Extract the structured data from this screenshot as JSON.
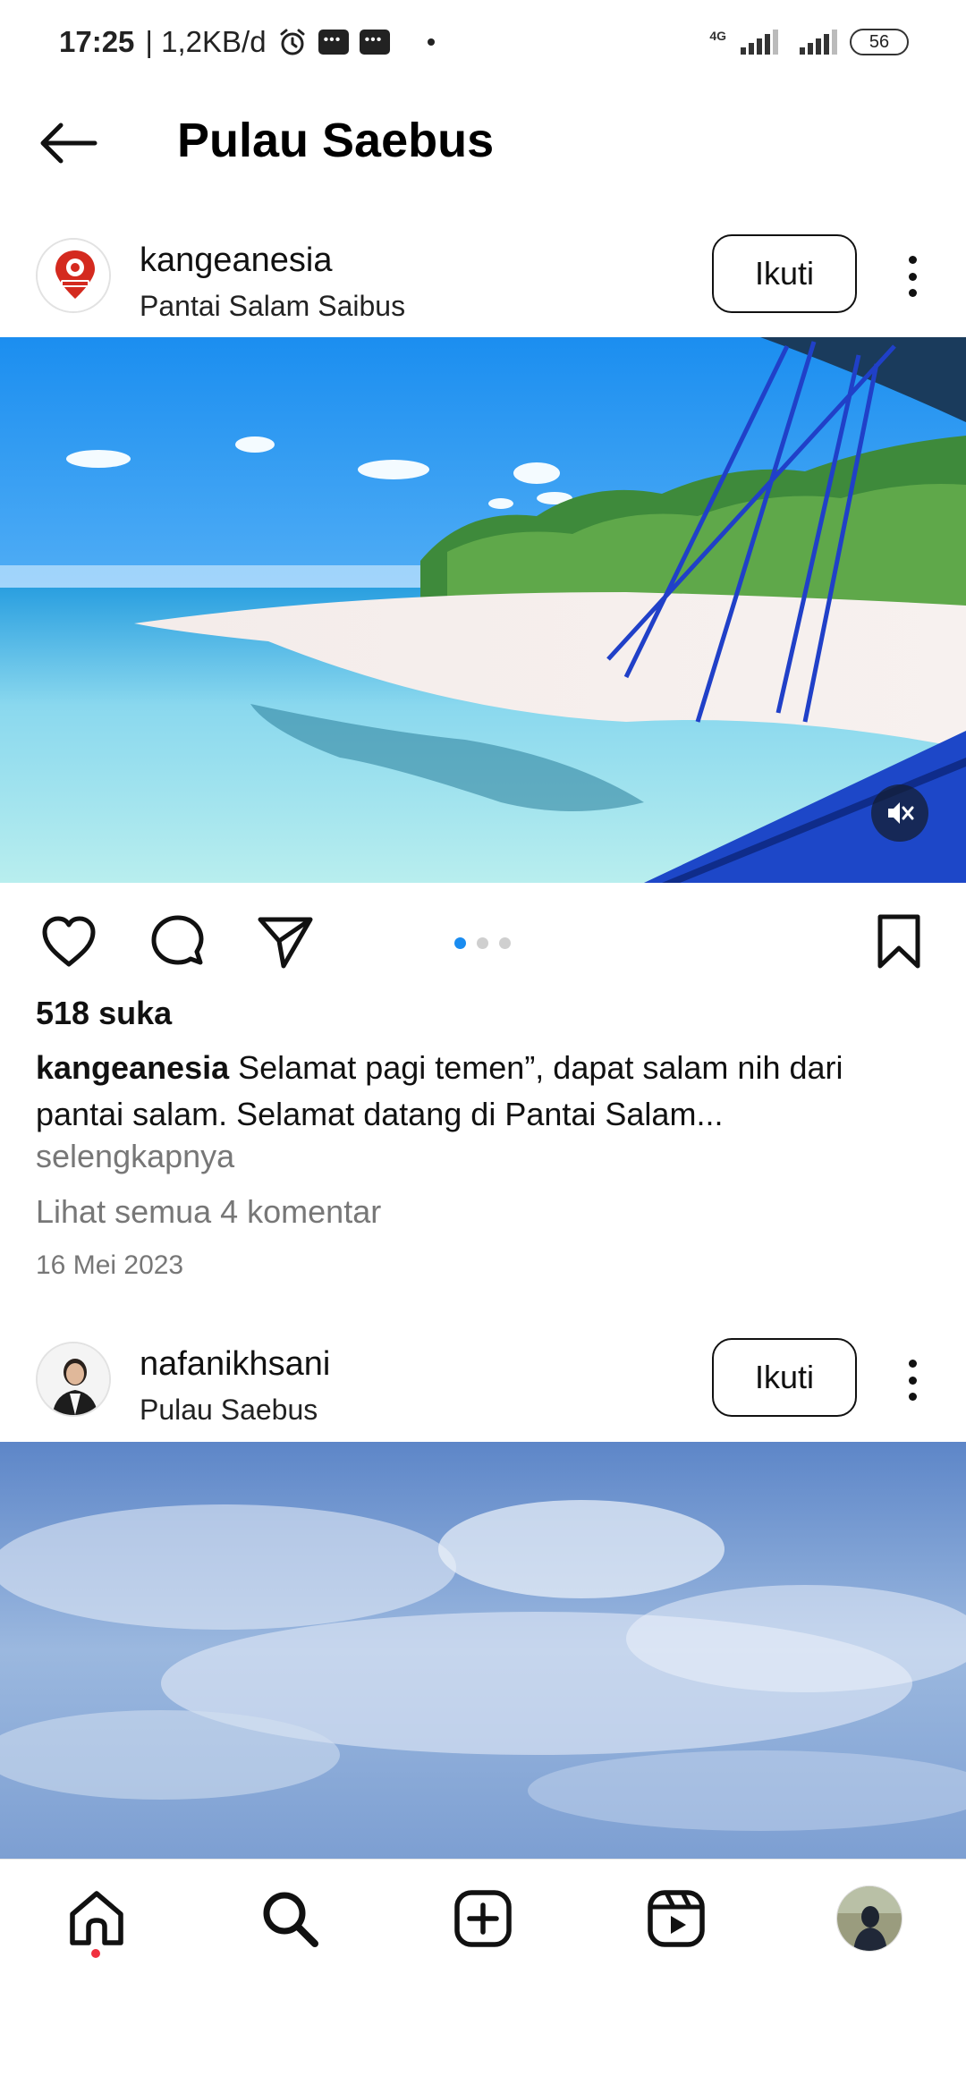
{
  "status_bar": {
    "time": "17:25",
    "network_speed": "| 1,2KB/d",
    "network_type": "4G",
    "battery": "56",
    "icons": [
      "alarm-icon",
      "message-icon",
      "message-icon",
      "notification-dot",
      "signal-icon",
      "signal-icon",
      "battery-icon"
    ]
  },
  "header": {
    "title": "Pulau Saebus",
    "back_icon": "arrow-left-icon"
  },
  "posts": [
    {
      "username": "kangeanesia",
      "location": "Pantai Salam Saibus",
      "follow_label": "Ikuti",
      "avatar_icon": "map-pin-logo",
      "image": "beach-photo",
      "mute_icon": "volume-muted-icon",
      "carousel": {
        "count": 3,
        "active": 1
      },
      "likes": "518 suka",
      "caption_user": "kangeanesia",
      "caption_text": " Selamat pagi temen”, dapat salam nih dari pantai salam. Selamat datang di Pantai Salam...",
      "more_label": "selengkapnya",
      "comments_label": "Lihat semua 4 komentar",
      "date": "16 Mei 2023"
    },
    {
      "username": "nafanikhsani",
      "location": "Pulau Saebus",
      "follow_label": "Ikuti",
      "avatar_icon": "person-photo",
      "image": "sky-photo"
    }
  ],
  "actions": {
    "like_icon": "heart-icon",
    "comment_icon": "comment-icon",
    "share_icon": "send-icon",
    "save_icon": "bookmark-icon"
  },
  "bottom_nav": {
    "items": [
      "home-icon",
      "search-icon",
      "create-icon",
      "reels-icon",
      "profile-avatar"
    ],
    "active": "home-icon",
    "accent": "#f0303f"
  },
  "colors": {
    "carousel_active": "#1a8cf0",
    "carousel_inactive": "#cfcfcf",
    "secondary_text": "#777777"
  }
}
